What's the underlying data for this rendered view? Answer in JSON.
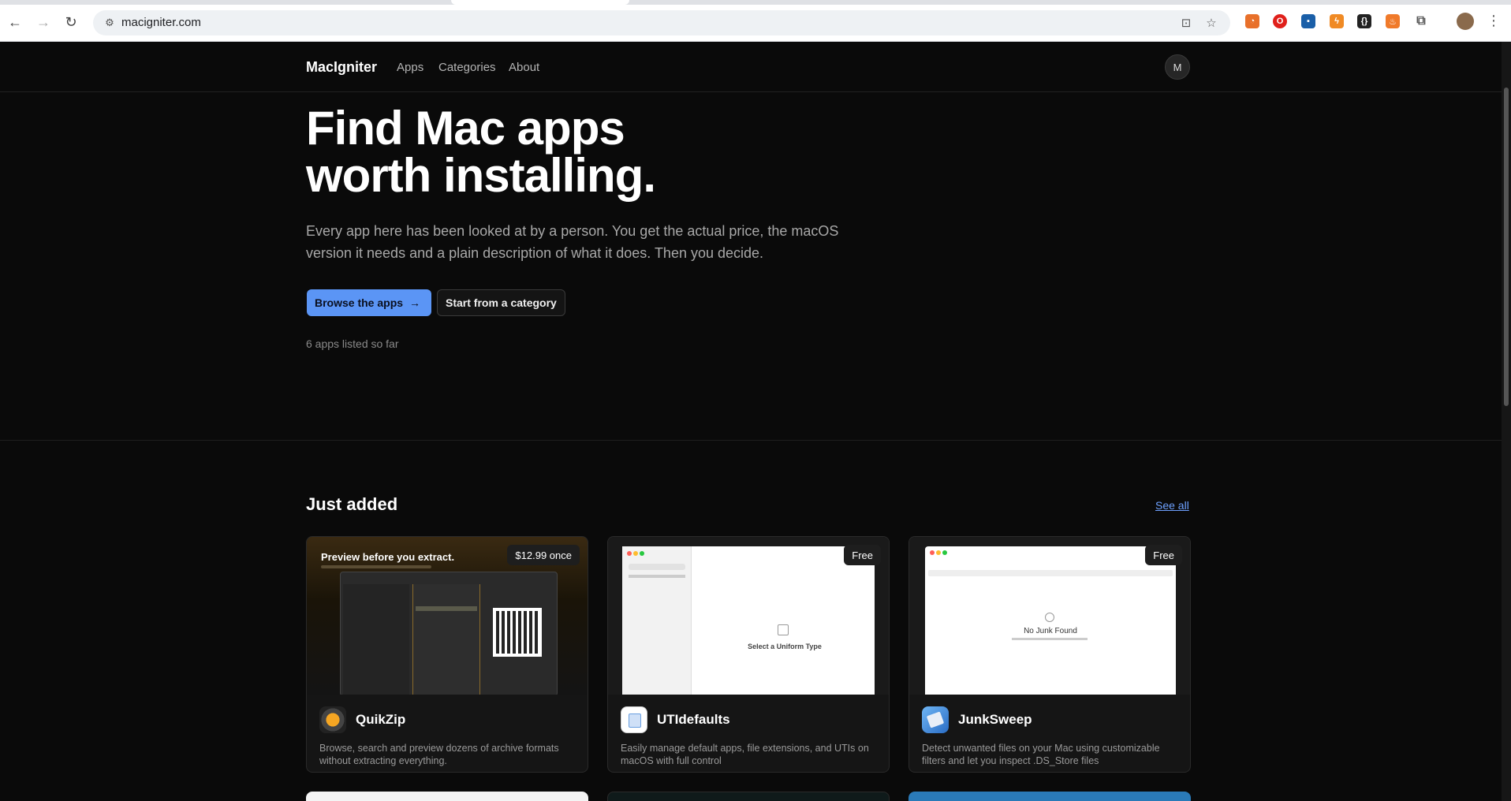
{
  "browser": {
    "url": "macigniter.com",
    "icons": [
      "back-icon",
      "forward-icon",
      "reload-icon",
      "site-info-icon",
      "install-icon",
      "bookmark-star-icon",
      "extensions-icon",
      "menu-icon"
    ]
  },
  "site_nav": {
    "brand": "MacIgniter",
    "links": [
      "Apps",
      "Categories",
      "About"
    ],
    "avatar_initial": "M"
  },
  "hero": {
    "title_line1": "Find Mac apps",
    "title_line2": "worth installing.",
    "subtitle": "Every app here has been looked at by a person. You get the actual price, the macOS version it needs and a plain description of what it does. Then you decide.",
    "primary_cta": "Browse the apps",
    "secondary_cta": "Start from a category",
    "count_text": "6 apps listed so far"
  },
  "just_added": {
    "title": "Just added",
    "see_all": "See all",
    "cards": [
      {
        "name": "QuikZip",
        "price": "$12.99 once",
        "description": "Browse, search and preview dozens of archive formats without extracting everything.",
        "shot_headline": "Preview before you extract.",
        "icon": "quikzip-icon"
      },
      {
        "name": "UTIdefaults",
        "price": "Free",
        "description": "Easily manage default apps, file extensions, and UTIs on macOS with full control",
        "shot_text": "Select a Uniform Type",
        "icon": "utidefaults-icon"
      },
      {
        "name": "JunkSweep",
        "price": "Free",
        "description": "Detect unwanted files on your Mac using customizable filters and let you inspect .DS_Store files",
        "shot_text": "No Junk Found",
        "icon": "junksweep-icon"
      }
    ]
  },
  "colors": {
    "background": "#0a0a0a",
    "accent": "#5b95f5",
    "link": "#6ea1ff"
  }
}
